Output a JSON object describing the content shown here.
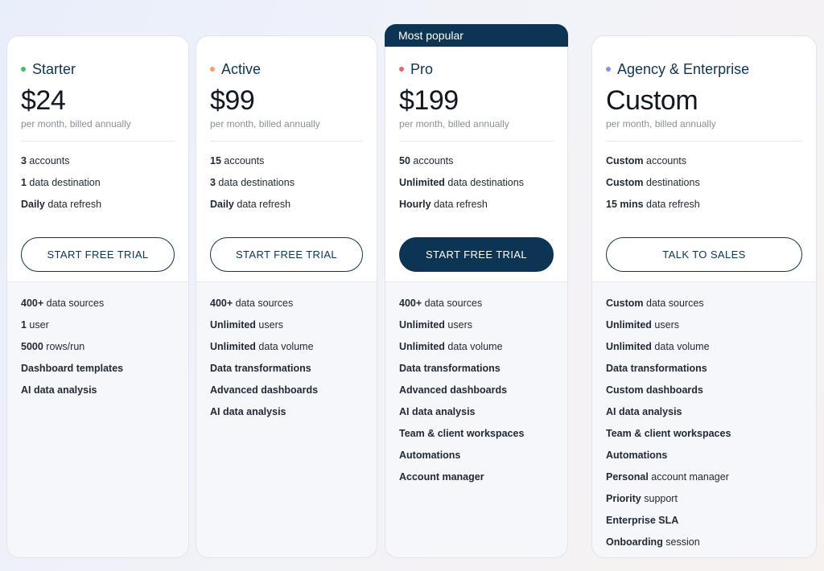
{
  "badge": "Most popular",
  "colors": {
    "navy": "#0b3552",
    "starter_dot": "#3fbf6a",
    "active_dot": "#f2a06a",
    "pro_dot": "#e8636e",
    "enterprise_dot": "#8a8ff0"
  },
  "plans": [
    {
      "name": "Starter",
      "price": "$24",
      "billing": "per month, billed annually",
      "quotas": [
        {
          "bold": "3",
          "text": " accounts"
        },
        {
          "bold": "1",
          "text": " data destination"
        },
        {
          "bold": "Daily",
          "text": " data refresh"
        }
      ],
      "cta": "START FREE TRIAL",
      "features": [
        {
          "bold": "400+",
          "text": " data sources"
        },
        {
          "bold": "1",
          "text": " user"
        },
        {
          "bold": "5000",
          "text": " rows/run"
        },
        {
          "bold": "Dashboard templates",
          "text": ""
        },
        {
          "bold": "AI data analysis",
          "text": ""
        }
      ]
    },
    {
      "name": "Active",
      "price": "$99",
      "billing": "per month, billed annually",
      "quotas": [
        {
          "bold": "15",
          "text": " accounts"
        },
        {
          "bold": "3",
          "text": " data destinations"
        },
        {
          "bold": "Daily",
          "text": " data refresh"
        }
      ],
      "cta": "START FREE TRIAL",
      "features": [
        {
          "bold": "400+",
          "text": " data sources"
        },
        {
          "bold": "Unlimited",
          "text": " users"
        },
        {
          "bold": "Unlimited",
          "text": " data volume"
        },
        {
          "bold": "Data transformations",
          "text": ""
        },
        {
          "bold": "Advanced dashboards",
          "text": ""
        },
        {
          "bold": "AI data analysis",
          "text": ""
        }
      ]
    },
    {
      "name": "Pro",
      "price": "$199",
      "billing": "per month, billed annually",
      "quotas": [
        {
          "bold": "50",
          "text": " accounts"
        },
        {
          "bold": "Unlimited",
          "text": " data destinations"
        },
        {
          "bold": "Hourly",
          "text": " data refresh"
        }
      ],
      "cta": "START FREE TRIAL",
      "features": [
        {
          "bold": "400+",
          "text": " data sources"
        },
        {
          "bold": "Unlimited",
          "text": " users"
        },
        {
          "bold": "Unlimited",
          "text": " data volume"
        },
        {
          "bold": "Data transformations",
          "text": ""
        },
        {
          "bold": "Advanced dashboards",
          "text": ""
        },
        {
          "bold": "AI data analysis",
          "text": ""
        },
        {
          "bold": "Team & client workspaces",
          "text": ""
        },
        {
          "bold": "Automations",
          "text": ""
        },
        {
          "bold": "Account manager",
          "text": ""
        }
      ]
    },
    {
      "name": "Agency & Enterprise",
      "price": "Custom",
      "billing": "per month, billed annually",
      "quotas": [
        {
          "bold": "Custom",
          "text": " accounts"
        },
        {
          "bold": "Custom",
          "text": " destinations"
        },
        {
          "bold": "15 mins",
          "text": " data refresh"
        }
      ],
      "cta": "TALK TO SALES",
      "features": [
        {
          "bold": "Custom",
          "text": " data sources"
        },
        {
          "bold": "Unlimited",
          "text": " users"
        },
        {
          "bold": "Unlimited",
          "text": " data volume"
        },
        {
          "bold": "Data transformations",
          "text": ""
        },
        {
          "bold": "Custom dashboards",
          "text": ""
        },
        {
          "bold": "AI data analysis",
          "text": ""
        },
        {
          "bold": "Team & client workspaces",
          "text": ""
        },
        {
          "bold": "Automations",
          "text": ""
        },
        {
          "bold": "Personal",
          "text": " account manager"
        },
        {
          "bold": "Priority",
          "text": " support"
        },
        {
          "bold": "Enterprise SLA",
          "text": ""
        },
        {
          "bold": "Onboarding",
          "text": " session"
        }
      ]
    }
  ]
}
